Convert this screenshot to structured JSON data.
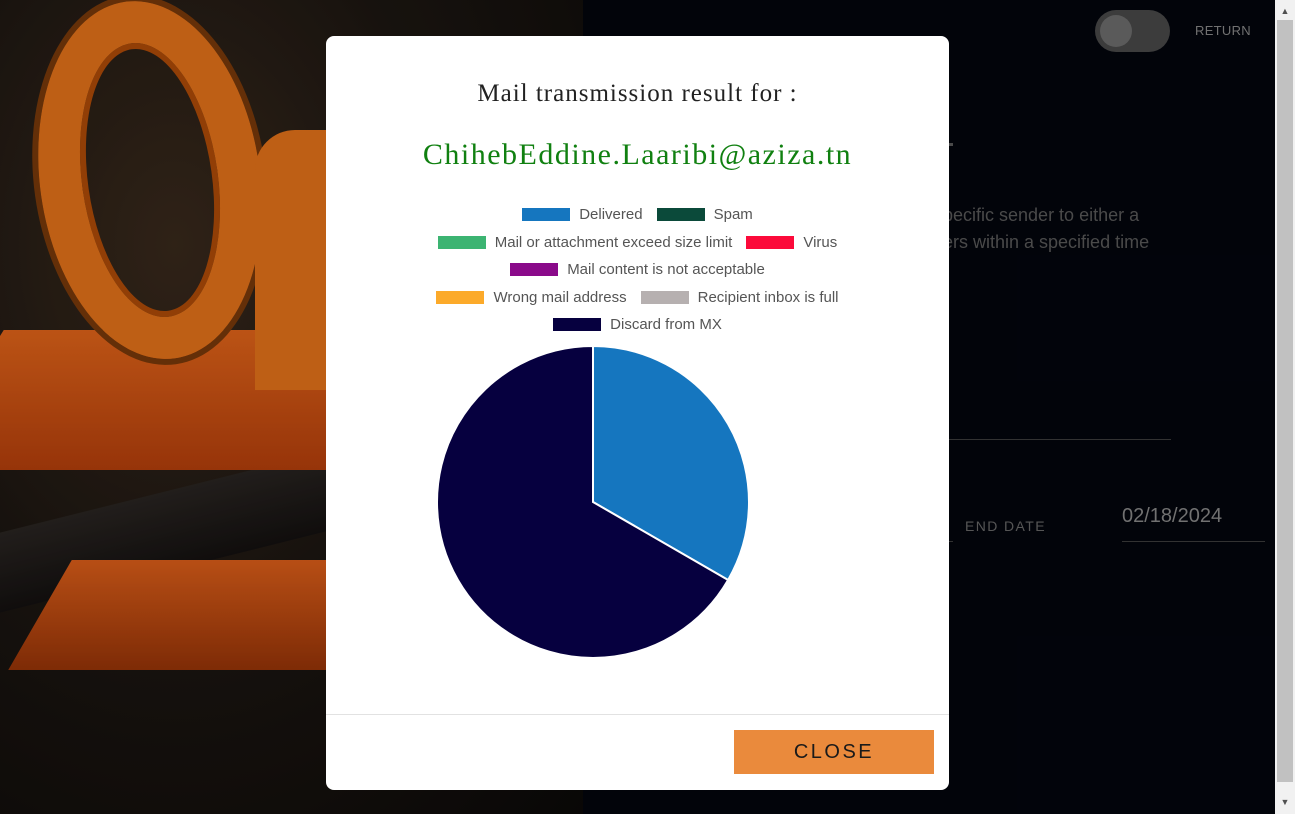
{
  "header": {
    "return_label": "RETURN",
    "toggle_state": "off"
  },
  "page": {
    "description_lines": [
      "pecific sender to either a",
      "ers within a specified time"
    ],
    "end_date_label": "END DATE",
    "end_date_value": "02/18/2024"
  },
  "modal": {
    "title": "Mail transmission result for :",
    "email": "ChihebEddine.Laaribi@aziza.tn",
    "close_label": "CLOSE"
  },
  "chart_data": {
    "type": "pie",
    "legend": [
      {
        "label": "Delivered",
        "color": "#1576bf"
      },
      {
        "label": "Spam",
        "color": "#0b4a3a"
      },
      {
        "label": "Mail or attachment exceed size limit",
        "color": "#3cb472"
      },
      {
        "label": "Virus",
        "color": "#fc0a3a"
      },
      {
        "label": "Mail content is not acceptable",
        "color": "#8a0a8a"
      },
      {
        "label": "Wrong mail address",
        "color": "#fcaa2a"
      },
      {
        "label": "Recipient inbox is full",
        "color": "#b6b0b0"
      },
      {
        "label": "Discard from MX",
        "color": "#06003f"
      }
    ],
    "values": [
      1,
      0,
      0,
      0,
      0,
      0,
      0,
      2
    ],
    "legend_position": "top"
  }
}
